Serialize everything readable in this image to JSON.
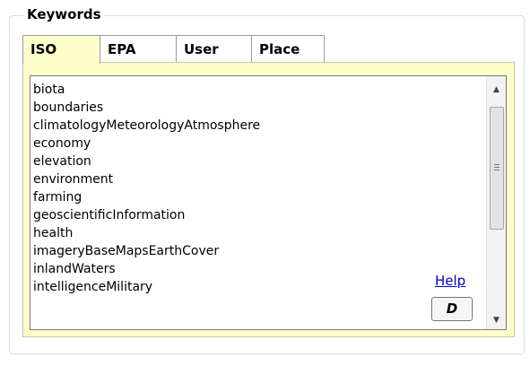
{
  "keywords": {
    "legend": "Keywords",
    "tabs": [
      {
        "label": "ISO",
        "active": true
      },
      {
        "label": "EPA",
        "active": false
      },
      {
        "label": "User",
        "active": false
      },
      {
        "label": "Place",
        "active": false
      }
    ],
    "list": [
      "biota",
      "boundaries",
      "climatologyMeteorologyAtmosphere",
      "economy",
      "elevation",
      "environment",
      "farming",
      "geoscientificInformation",
      "health",
      "imageryBaseMapsEarthCover",
      "inlandWaters",
      "intelligenceMilitary"
    ],
    "help_label": "Help",
    "d_button_label": "D"
  },
  "colors": {
    "panel_background": "#ffffcc",
    "link": "#0000cc"
  },
  "icons": {
    "scroll_up": "triangle-up-icon",
    "scroll_down": "triangle-down-icon",
    "scroll_grip": "grip-lines-icon"
  }
}
